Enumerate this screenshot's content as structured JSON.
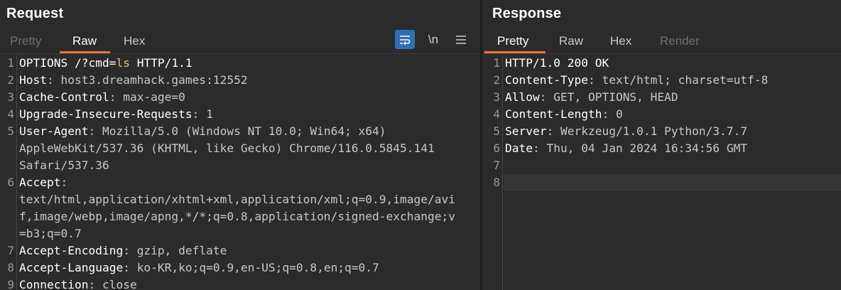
{
  "request": {
    "title": "Request",
    "tabs": [
      "Pretty",
      "Raw",
      "Hex"
    ],
    "active_tab": "Raw",
    "toolbar": {
      "wrap_icon": "wrap-lines-icon",
      "newline_label": "\\n",
      "menu_icon": "hamburger-menu-icon"
    },
    "lines": [
      {
        "n": "1",
        "rows": [
          [
            "OPTIONS /?cmd=",
            "",
            ""
          ]
        ],
        "special": "cmd"
      },
      {
        "n": "2",
        "key": "Host",
        "val": "host3.dreamhack.games:12552"
      },
      {
        "n": "3",
        "key": "Cache-Control",
        "val": "max-age=0"
      },
      {
        "n": "4",
        "key": "Upgrade-Insecure-Requests",
        "val": "1"
      },
      {
        "n": "5",
        "key": "User-Agent",
        "val": "Mozilla/5.0 (Windows NT 10.0; Win64; x64)",
        "cont": [
          "AppleWebKit/537.36 (KHTML, like Gecko) Chrome/116.0.5845.141",
          "Safari/537.36"
        ]
      },
      {
        "n": "6",
        "key": "Accept",
        "val": "",
        "cont": [
          "text/html,application/xhtml+xml,application/xml;q=0.9,image/avi",
          "f,image/webp,image/apng,*/*;q=0.8,application/signed-exchange;v",
          "=b3;q=0.7"
        ]
      },
      {
        "n": "7",
        "key": "Accept-Encoding",
        "val": "gzip, deflate"
      },
      {
        "n": "8",
        "key": "Accept-Language",
        "val": "ko-KR,ko;q=0.9,en-US;q=0.8,en;q=0.7"
      },
      {
        "n": "9",
        "key": "Connection",
        "val": "close"
      }
    ],
    "first_line": {
      "prefix": "OPTIONS /?cmd=",
      "param": "ls",
      "suffix": " HTTP/1.1"
    }
  },
  "response": {
    "title": "Response",
    "tabs": [
      "Pretty",
      "Raw",
      "Hex",
      "Render"
    ],
    "active_tab": "Pretty",
    "status_line": "HTTP/1.0 200 OK",
    "headers": [
      {
        "n": "2",
        "key": "Content-Type",
        "val": "text/html; charset=utf-8"
      },
      {
        "n": "3",
        "key": "Allow",
        "val": "GET, OPTIONS, HEAD"
      },
      {
        "n": "4",
        "key": "Content-Length",
        "val": "0"
      },
      {
        "n": "5",
        "key": "Server",
        "val": "Werkzeug/1.0.1 Python/3.7.7"
      },
      {
        "n": "6",
        "key": "Date",
        "val": "Thu, 04 Jan 2024 16:34:56 GMT"
      }
    ],
    "empty_lines": [
      "7",
      "8"
    ]
  },
  "colors": {
    "accent_tab": "#e8743b",
    "active_toggle": "#2f6fb5",
    "param_highlight": "#e5c07b"
  }
}
